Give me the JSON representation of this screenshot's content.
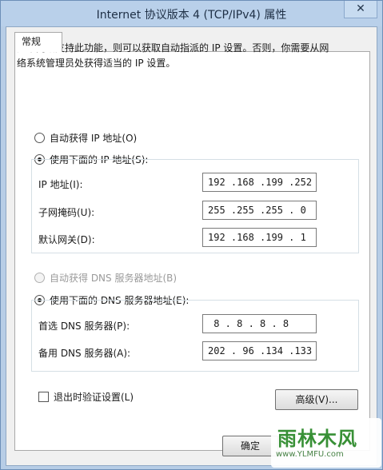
{
  "window": {
    "title": "Internet 协议版本 4 (TCP/IPv4) 属性",
    "close_glyph": "✕"
  },
  "tabs": [
    {
      "label": "常规"
    }
  ],
  "description": {
    "line1": "如果网络支持此功能，则可以获取自动指派的 IP 设置。否则，你需要从网",
    "line2": "络系统管理员处获得适当的 IP 设置。"
  },
  "ip": {
    "auto_label": "自动获得 IP 地址(O)",
    "manual_label": "使用下面的 IP 地址(S):",
    "selected": "manual",
    "fields": [
      {
        "label": "IP 地址(I):",
        "value": "192 .168 .199 .252"
      },
      {
        "label": "子网掩码(U):",
        "value": "255 .255 .255 . 0"
      },
      {
        "label": "默认网关(D):",
        "value": "192 .168 .199 . 1"
      }
    ]
  },
  "dns": {
    "auto_label": "自动获得 DNS 服务器地址(B)",
    "manual_label": "使用下面的 DNS 服务器地址(E):",
    "selected": "manual",
    "auto_disabled": true,
    "fields": [
      {
        "label": "首选 DNS 服务器(P):",
        "value": " 8 . 8 . 8 . 8"
      },
      {
        "label": "备用 DNS 服务器(A):",
        "value": "202 . 96 .134 .133"
      }
    ]
  },
  "validate_checkbox": {
    "label": "退出时验证设置(L)",
    "checked": false
  },
  "buttons": {
    "advanced": "高级(V)...",
    "ok": "确定"
  },
  "watermark": {
    "name": "雨林木风",
    "url": "www.YLMFU.com"
  }
}
